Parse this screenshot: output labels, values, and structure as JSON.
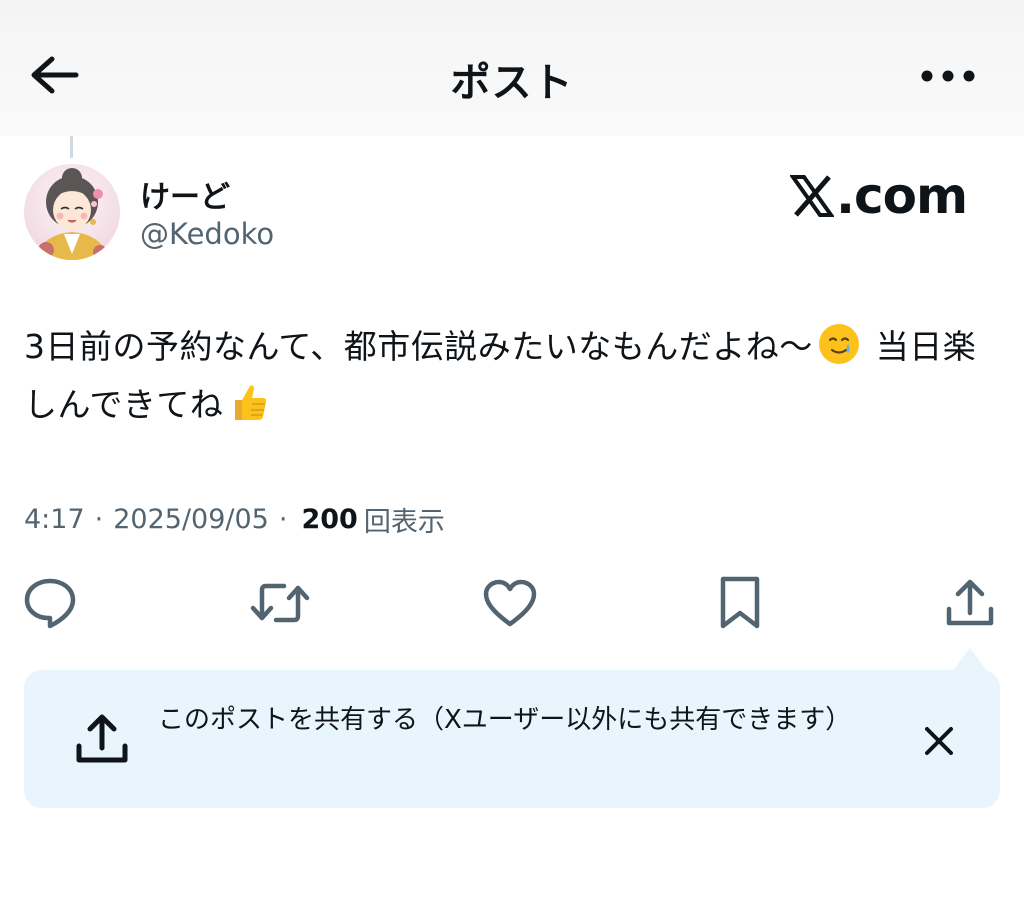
{
  "header": {
    "title": "ポスト",
    "back_icon": "arrow-left-icon",
    "more_icon": "more-horizontal-icon"
  },
  "author": {
    "display_name": "けーど",
    "handle": "@Kedoko",
    "avatar": "illustrated-avatar"
  },
  "watermark": {
    "text": ".com",
    "logo": "x-logo"
  },
  "post": {
    "text_part1": "3日前の予約なんて、都市伝説みたいなもんだよね〜",
    "emoji1": "smiling-face-with-tear-emoji",
    "text_part2": " 当日楽しんできてね",
    "emoji2": "thumbs-up-emoji"
  },
  "meta": {
    "time": "4:17",
    "separator": "·",
    "date": "2025/09/05",
    "views_count": "200",
    "views_label": "回表示"
  },
  "actions": [
    {
      "name": "reply",
      "icon": "reply-icon"
    },
    {
      "name": "repost",
      "icon": "repost-icon"
    },
    {
      "name": "like",
      "icon": "heart-icon"
    },
    {
      "name": "bookmark",
      "icon": "bookmark-icon"
    },
    {
      "name": "share",
      "icon": "share-icon"
    }
  ],
  "share_tip": {
    "text": "このポストを共有する（Xユーザー以外にも共有できます）",
    "icon": "share-icon",
    "close_icon": "close-icon",
    "background": "#e8f5fd"
  },
  "colors": {
    "text_primary": "#0f1419",
    "text_secondary": "#536471",
    "icon": "#536471"
  }
}
